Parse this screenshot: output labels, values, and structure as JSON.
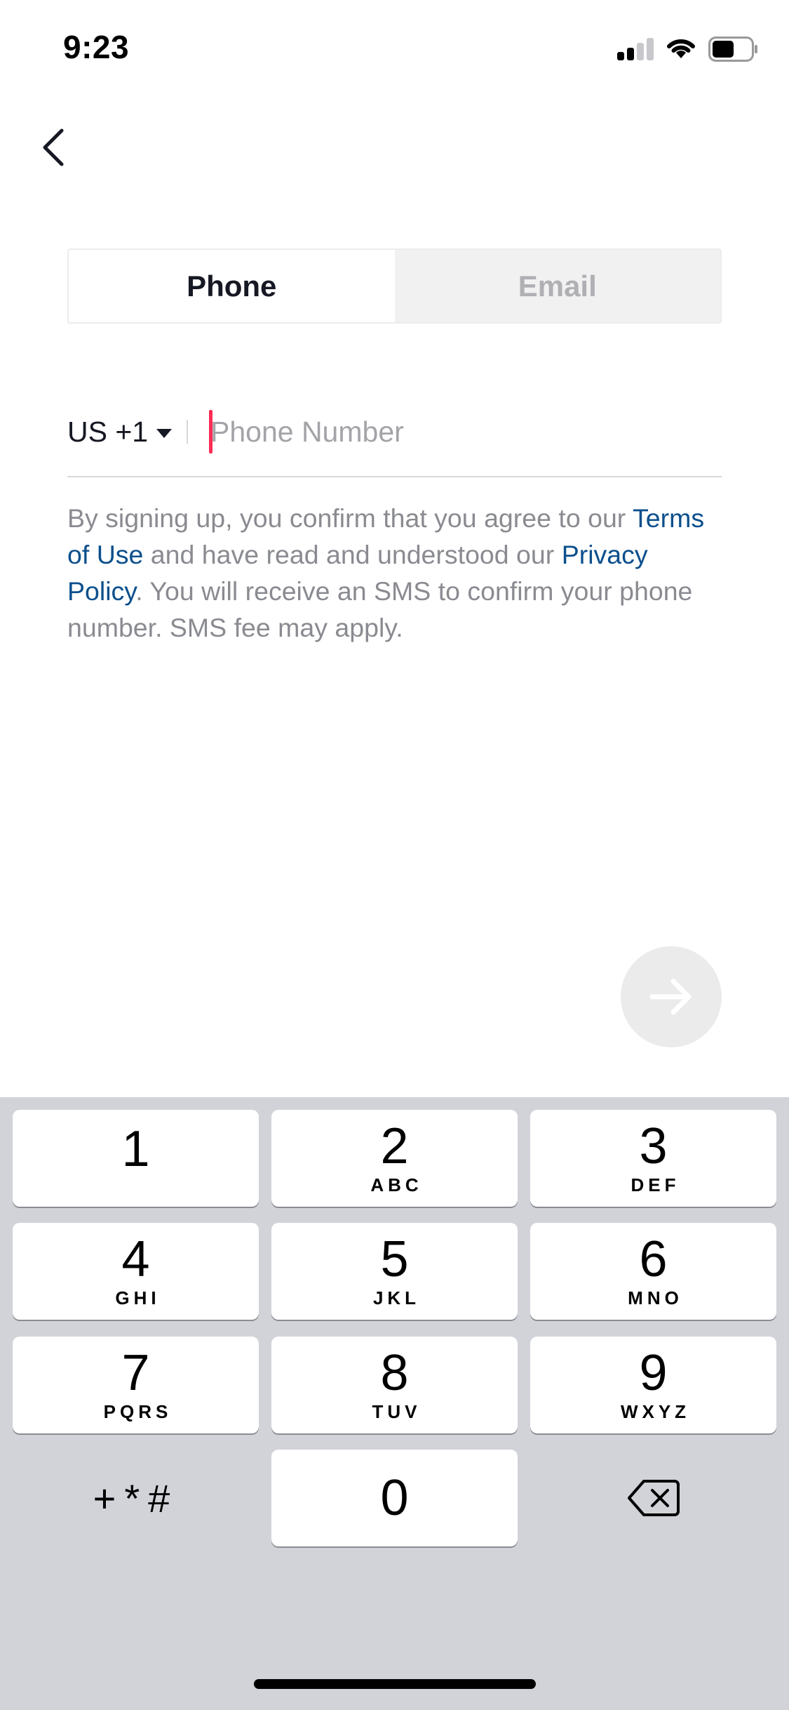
{
  "status_bar": {
    "time": "9:23"
  },
  "tabs": [
    {
      "label": "Phone",
      "active": true
    },
    {
      "label": "Email",
      "active": false
    }
  ],
  "phone_form": {
    "country_code": "US +1",
    "placeholder": "Phone Number",
    "value": ""
  },
  "terms": {
    "part1": "By signing up, you confirm that you agree to our ",
    "terms_link": "Terms of Use",
    "part2": " and have read and understood our ",
    "privacy_link": "Privacy Policy",
    "part3": ". You will receive an SMS to confirm your phone number. SMS fee may apply."
  },
  "colors": {
    "accent": "#fe2c55",
    "link": "#0b4f8c",
    "keyboard_bg": "#d1d3d9"
  },
  "keypad": {
    "k1": {
      "num": "1",
      "letters": ""
    },
    "k2": {
      "num": "2",
      "letters": "ABC"
    },
    "k3": {
      "num": "3",
      "letters": "DEF"
    },
    "k4": {
      "num": "4",
      "letters": "GHI"
    },
    "k5": {
      "num": "5",
      "letters": "JKL"
    },
    "k6": {
      "num": "6",
      "letters": "MNO"
    },
    "k7": {
      "num": "7",
      "letters": "PQRS"
    },
    "k8": {
      "num": "8",
      "letters": "TUV"
    },
    "k9": {
      "num": "9",
      "letters": "WXYZ"
    },
    "k0": {
      "num": "0",
      "letters": ""
    },
    "symbols": "+*#"
  },
  "icons": [
    "signal-icon",
    "wifi-icon",
    "battery-icon",
    "back-arrow-icon",
    "caret-down-icon",
    "arrow-right-icon",
    "backspace-icon"
  ]
}
